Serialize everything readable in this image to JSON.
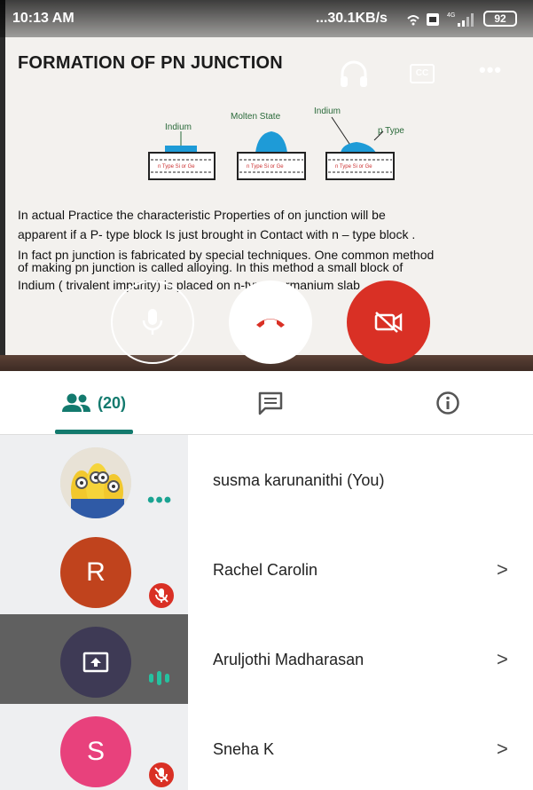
{
  "status_bar": {
    "time": "10:13 AM",
    "network": "...30.1KB/s",
    "battery": "92"
  },
  "slide": {
    "title": "FORMATION OF PN JUNCTION",
    "labels": {
      "indium_left": "Indium",
      "molten": "Molten State",
      "indium_right": "Indium",
      "ptype": "p Type",
      "block": "n Type Si or Ge"
    },
    "paragraph_lines": [
      "In actual  Practice the characteristic Properties  of on junction will be",
      "apparent if a P- type block Is just brought in Contact with n – type block .",
      "In fact pn junction is fabricated by special techniques. One common method",
      "of making  pn junction is called alloying. In this method a small block of",
      "Indium ( trivalent impurity) is placed on n-type germanium slab ."
    ]
  },
  "video_controls": {
    "audio_icon": "headphones-icon",
    "captions_label": "CC",
    "more_label": "•••",
    "mic_icon": "mic-icon",
    "end_call_icon": "end-call-icon",
    "camera_icon": "camera-off-icon"
  },
  "tabs": {
    "people_count": "(20)",
    "people_icon": "people-icon",
    "chat_icon": "chat-icon",
    "info_icon": "info-icon"
  },
  "participants": [
    {
      "name": "susma karunanithi (You)",
      "avatar": "photo",
      "status": "dots"
    },
    {
      "name": "Rachel Carolin",
      "avatar_letter": "R",
      "avatar_color": "#c0431d",
      "status": "muted"
    },
    {
      "name": "Aruljothi Madharasan",
      "avatar": "present-screen-icon",
      "avatar_color": "#3e3a55",
      "status": "speaking"
    },
    {
      "name": "Sneha K",
      "avatar_letter": "S",
      "avatar_color": "#e8417c",
      "status": "muted"
    }
  ],
  "chevron": ">",
  "colors": {
    "accent": "#137a6e",
    "end_call_red": "#d93025",
    "speaking": "#25c2a0"
  }
}
